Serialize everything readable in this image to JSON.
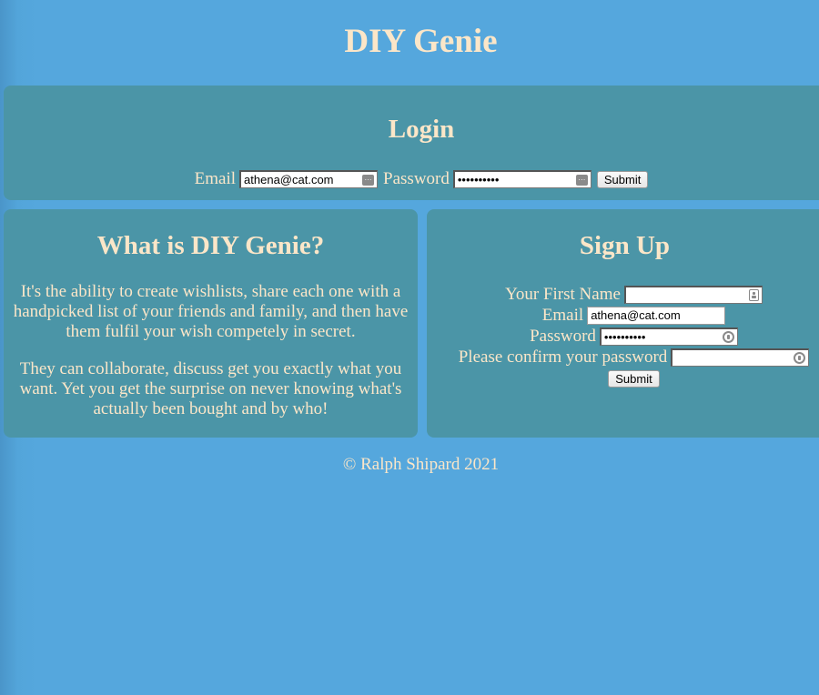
{
  "site": {
    "title": "DIY Genie"
  },
  "login": {
    "heading": "Login",
    "email_label": "Email",
    "email_value": "athena@cat.com",
    "password_label": "Password",
    "password_value": "••••••••••",
    "submit_label": "Submit"
  },
  "about": {
    "heading": "What is DIY Genie?",
    "paragraphs": [
      "It's the ability to create wishlists, share each one with a handpicked list of your friends and family, and then have them fulfil your wish competely in secret.",
      "They can collaborate, discuss get you exactly what you want. Yet you get the surprise on never knowing what's actually been bought and by who!"
    ]
  },
  "signup": {
    "heading": "Sign Up",
    "first_name_label": "Your First Name",
    "first_name_value": "",
    "email_label": "Email",
    "email_value": "athena@cat.com",
    "password_label": "Password",
    "password_value": "••••••••••",
    "confirm_label": "Please confirm your password",
    "confirm_value": "",
    "submit_label": "Submit"
  },
  "footer": {
    "text": "© Ralph Shipard 2021"
  },
  "colors": {
    "background": "#55a7dd",
    "panel": "#4b95a7",
    "text": "#fbe6c8"
  }
}
